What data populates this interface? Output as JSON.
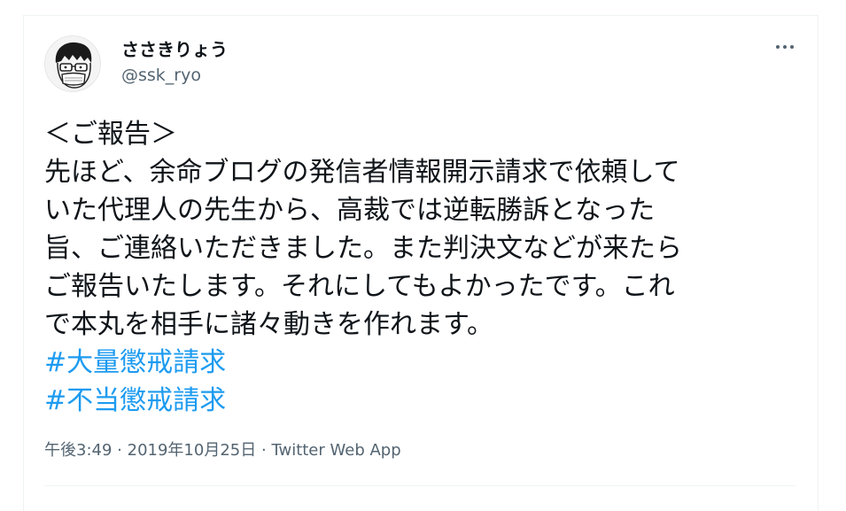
{
  "tweet": {
    "author": {
      "display_name": "ささきりょう",
      "handle": "@ssk_ryo"
    },
    "more_icon": "more-horizontal-icon",
    "lines": [
      "＜ご報告＞",
      "先ほど、余命ブログの発信者情報開示請求で依頼して",
      "いた代理人の先生から、高裁では逆転勝訴となった",
      "旨、ご連絡いただきました。また判決文などが来たら",
      "ご報告いたします。それにしてもよかったです。これ",
      "で本丸を相手に諸々動きを作れます。"
    ],
    "hashtags": [
      "#大量懲戒請求",
      "#不当懲戒請求"
    ],
    "time": "午後3:49",
    "separator": "·",
    "date": "2019年10月25日",
    "source": "Twitter Web App"
  },
  "colors": {
    "text": "#0f1419",
    "secondary": "#536471",
    "link": "#1d9bf0",
    "border": "#eff3f4"
  }
}
